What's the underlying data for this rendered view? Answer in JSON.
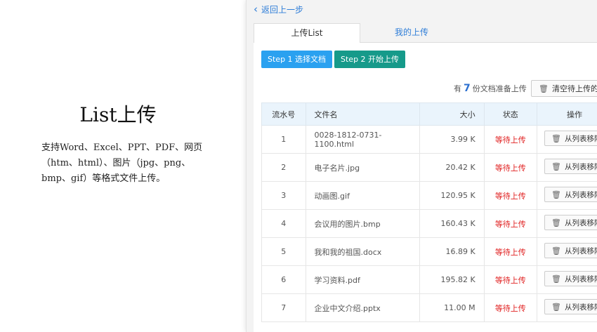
{
  "intro": {
    "title": "List上传",
    "description": "支持Word、Excel、PPT、PDF、网页（htm、html）、图片（jpg、png、bmp、gif）等格式文件上传。"
  },
  "nav": {
    "back_label": "返回上一步"
  },
  "tabs": [
    {
      "label": "上传List"
    },
    {
      "label": "我的上传"
    }
  ],
  "toolbar": {
    "step1_label": "Step 1 选择文档",
    "step2_label": "Step 2 开始上传",
    "count_prefix": "有",
    "count": "7",
    "count_suffix": "份文档准备上传",
    "clear_label": "清空待上传的List"
  },
  "table": {
    "headers": [
      "流水号",
      "文件名",
      "大小",
      "状态",
      "操作"
    ],
    "rows": [
      {
        "no": "1",
        "name": "0028-1812-0731-1100.html",
        "size": "3.99 K",
        "status": "等待上传",
        "action": "从列表移除"
      },
      {
        "no": "2",
        "name": "电子名片.jpg",
        "size": "20.42 K",
        "status": "等待上传",
        "action": "从列表移除"
      },
      {
        "no": "3",
        "name": "动画图.gif",
        "size": "120.95 K",
        "status": "等待上传",
        "action": "从列表移除"
      },
      {
        "no": "4",
        "name": "会议用的图片.bmp",
        "size": "160.43 K",
        "status": "等待上传",
        "action": "从列表移除"
      },
      {
        "no": "5",
        "name": "我和我的祖国.docx",
        "size": "16.89 K",
        "status": "等待上传",
        "action": "从列表移除"
      },
      {
        "no": "6",
        "name": "学习资料.pdf",
        "size": "195.82 K",
        "status": "等待上传",
        "action": "从列表移除"
      },
      {
        "no": "7",
        "name": "企业中文介绍.pptx",
        "size": "11.00 M",
        "status": "等待上传",
        "action": "从列表移除"
      }
    ]
  },
  "colors": {
    "accent": "#2aa1f0",
    "step2": "#169a8a",
    "status_waiting": "#e02020",
    "link": "#2f7ed8"
  },
  "icons": {
    "back": "chevron-left-icon",
    "trash": "trash-icon"
  }
}
